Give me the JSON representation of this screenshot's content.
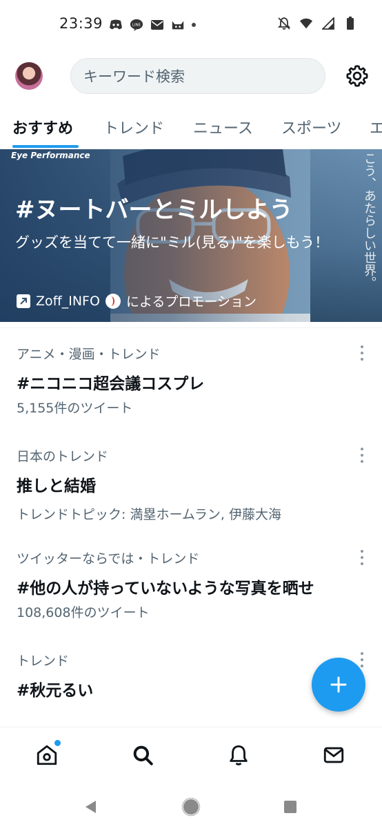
{
  "status_bar": {
    "time": "23:39",
    "left_icons": [
      "discord-icon",
      "line-icon",
      "mail-icon",
      "cat-icon",
      "notification-dot"
    ],
    "right_icons": [
      "bell-off-icon",
      "wifi-icon",
      "signal-icon",
      "battery-icon"
    ]
  },
  "header": {
    "search_placeholder": "キーワード検索"
  },
  "tabs": [
    {
      "label": "おすすめ",
      "active": true
    },
    {
      "label": "トレンド",
      "active": false
    },
    {
      "label": "ニュース",
      "active": false
    },
    {
      "label": "スポーツ",
      "active": false
    },
    {
      "label": "エ",
      "active": false
    }
  ],
  "promo": {
    "brand": "Eye Performance",
    "vertical_text": "こう、あたらしい世界。",
    "title": "#ヌートバーとミルしよう",
    "subtitle": "グッズを当てて一緒に\"ミル(見る)\"を楽しもう！",
    "handle": "Zoff_INFO",
    "promoted_by": "によるプロモーション"
  },
  "trends": [
    {
      "category": "アニメ・漫画・トレンド",
      "title": "#ニコニコ超会議コスプレ",
      "meta": "5,155件のツイート"
    },
    {
      "category": "日本のトレンド",
      "title": "推しと結婚",
      "meta": "トレンドトピック: 満塁ホームラン, 伊藤大海"
    },
    {
      "category": "ツイッターならでは・トレンド",
      "title": "#他の人が持っていないような写真を晒せ",
      "meta": "108,608件のツイート"
    },
    {
      "category": "トレンド",
      "title": "#秋元るい",
      "meta": ""
    }
  ],
  "colors": {
    "accent": "#1d9bf0",
    "text_primary": "#0f1419",
    "text_secondary": "#536471"
  }
}
